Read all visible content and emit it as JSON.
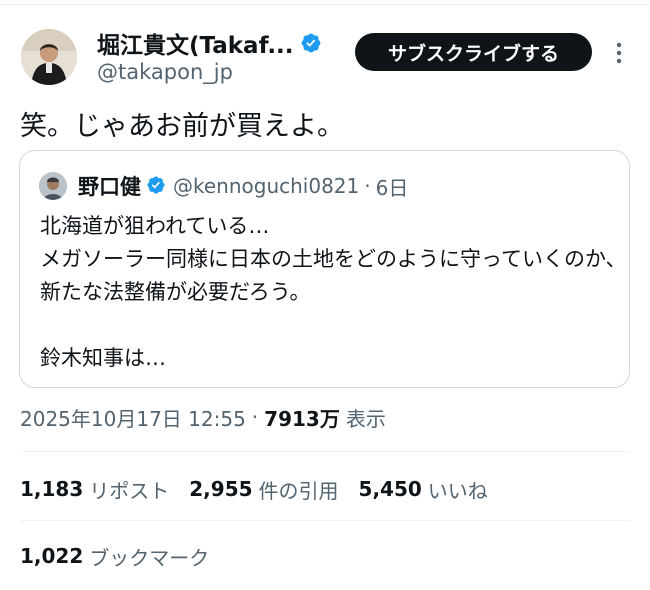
{
  "author": {
    "name": "堀江貴文(Takaf...",
    "handle": "@takapon_jp",
    "verified": true
  },
  "subscribe_label": "サブスクライブする",
  "tweet": {
    "text": "笑。じゃあお前が買えよ。"
  },
  "quote": {
    "name": "野口健",
    "handle": "@kennoguchi0821",
    "dot": "·",
    "time": "6日",
    "text": "北海道が狙われている…\nメガソーラー同様に日本の土地をどのように守っていくのか、新たな法整備が必要だろう。\n\n鈴木知事は…"
  },
  "meta": {
    "datetime": "2025年10月17日 12:55",
    "dot": "·",
    "views_count": "7913万",
    "views_label": "表示"
  },
  "stats": {
    "reposts_count": "1,183",
    "reposts_label": "リポスト",
    "quotes_count": "2,955",
    "quotes_label": "件の引用",
    "likes_count": "5,450",
    "likes_label": "いいね",
    "bookmarks_count": "1,022",
    "bookmarks_label": "ブックマーク"
  },
  "colors": {
    "verified_blue": "#1d9bf0",
    "text_primary": "#0f1419",
    "text_secondary": "#536471",
    "border": "#cfd9de"
  },
  "icons": {
    "verified": "verified-badge-icon",
    "more": "more-options-icon"
  }
}
